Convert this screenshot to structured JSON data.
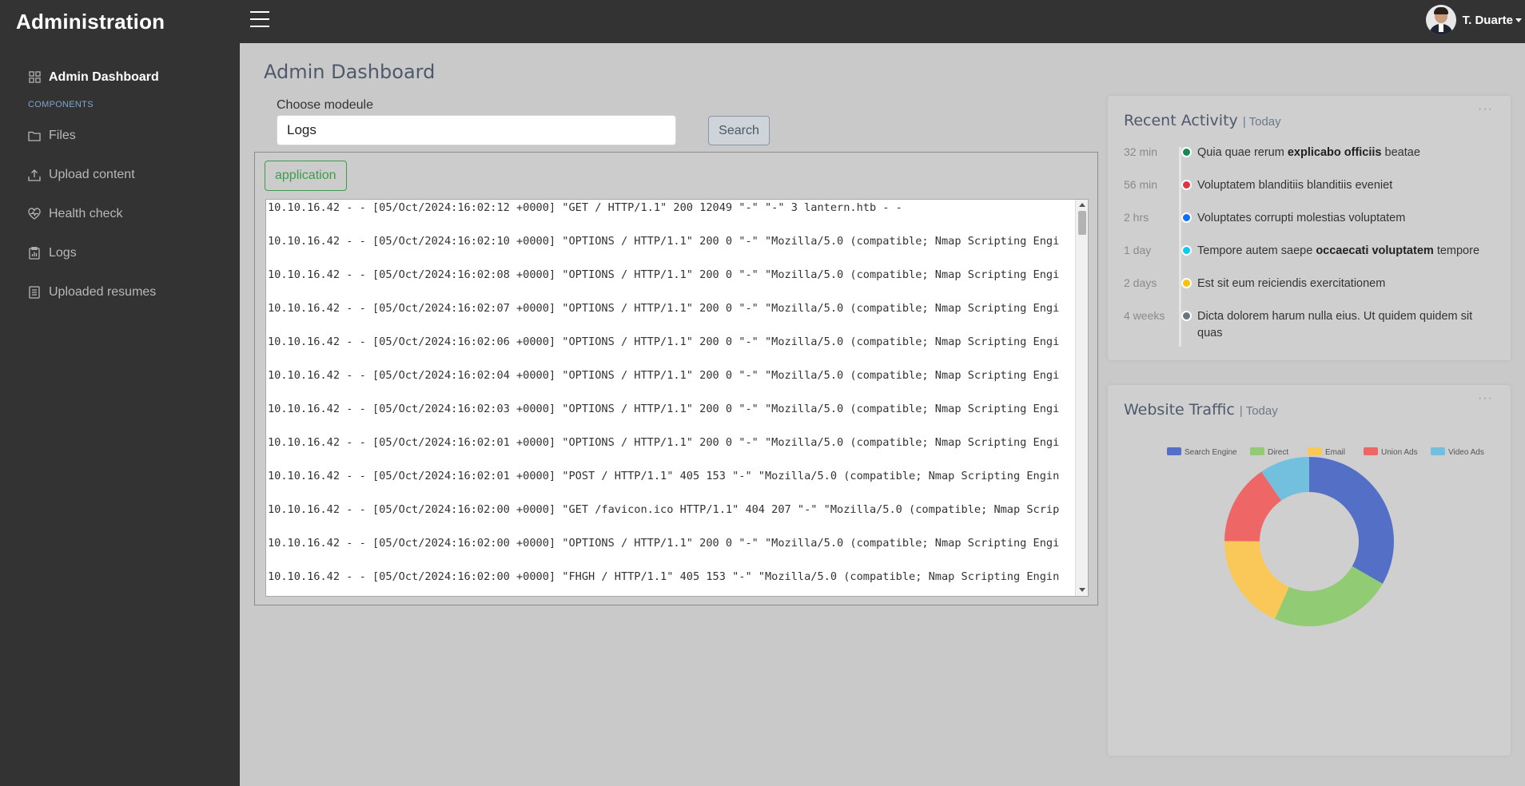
{
  "header": {
    "brand": "Administration",
    "user_name": "T. Duarte"
  },
  "sidebar": {
    "items": [
      {
        "label": "Admin Dashboard",
        "icon": "grid-icon"
      },
      {
        "heading": "COMPONENTS"
      },
      {
        "label": "Files",
        "icon": "folder-icon"
      },
      {
        "label": "Upload content",
        "icon": "upload-icon"
      },
      {
        "label": "Health check",
        "icon": "heart-pulse-icon"
      },
      {
        "label": "Logs",
        "icon": "clipboard-data-icon"
      },
      {
        "label": "Uploaded resumes",
        "icon": "document-list-icon"
      }
    ]
  },
  "main": {
    "title": "Admin Dashboard",
    "module_label": "Choose modeule",
    "module_value": "Logs",
    "search_label": "Search",
    "log_tab": "application",
    "log_lines": [
      "10.10.16.42 - - [05/Oct/2024:16:02:12 +0000] \"GET / HTTP/1.1\" 200 12049 \"-\" \"-\" 3 lantern.htb - -",
      "10.10.16.42 - - [05/Oct/2024:16:02:10 +0000] \"OPTIONS / HTTP/1.1\" 200 0 \"-\" \"Mozilla/5.0 (compatible; Nmap Scripting Engi",
      "10.10.16.42 - - [05/Oct/2024:16:02:08 +0000] \"OPTIONS / HTTP/1.1\" 200 0 \"-\" \"Mozilla/5.0 (compatible; Nmap Scripting Engi",
      "10.10.16.42 - - [05/Oct/2024:16:02:07 +0000] \"OPTIONS / HTTP/1.1\" 200 0 \"-\" \"Mozilla/5.0 (compatible; Nmap Scripting Engi",
      "10.10.16.42 - - [05/Oct/2024:16:02:06 +0000] \"OPTIONS / HTTP/1.1\" 200 0 \"-\" \"Mozilla/5.0 (compatible; Nmap Scripting Engi",
      "10.10.16.42 - - [05/Oct/2024:16:02:04 +0000] \"OPTIONS / HTTP/1.1\" 200 0 \"-\" \"Mozilla/5.0 (compatible; Nmap Scripting Engi",
      "10.10.16.42 - - [05/Oct/2024:16:02:03 +0000] \"OPTIONS / HTTP/1.1\" 200 0 \"-\" \"Mozilla/5.0 (compatible; Nmap Scripting Engi",
      "10.10.16.42 - - [05/Oct/2024:16:02:01 +0000] \"OPTIONS / HTTP/1.1\" 200 0 \"-\" \"Mozilla/5.0 (compatible; Nmap Scripting Engi",
      "10.10.16.42 - - [05/Oct/2024:16:02:01 +0000] \"POST / HTTP/1.1\" 405 153 \"-\" \"Mozilla/5.0 (compatible; Nmap Scripting Engin",
      "10.10.16.42 - - [05/Oct/2024:16:02:00 +0000] \"GET /favicon.ico HTTP/1.1\" 404 207 \"-\" \"Mozilla/5.0 (compatible; Nmap Scrip",
      "10.10.16.42 - - [05/Oct/2024:16:02:00 +0000] \"OPTIONS / HTTP/1.1\" 200 0 \"-\" \"Mozilla/5.0 (compatible; Nmap Scripting Engi",
      "10.10.16.42 - - [05/Oct/2024:16:02:00 +0000] \"FHGH / HTTP/1.1\" 405 153 \"-\" \"Mozilla/5.0 (compatible; Nmap Scripting Engin"
    ]
  },
  "activity": {
    "title": "Recent Activity",
    "subtitle": "| Today",
    "dots": "···",
    "items": [
      {
        "time": "32 min",
        "color": "#198754",
        "pre": "Quia quae rerum ",
        "bold": "explicabo officiis",
        "post": " beatae"
      },
      {
        "time": "56 min",
        "color": "#dc3545",
        "pre": "Voluptatem blanditiis blanditiis eveniet",
        "bold": "",
        "post": ""
      },
      {
        "time": "2 hrs",
        "color": "#0d6efd",
        "pre": "Voluptates corrupti molestias voluptatem",
        "bold": "",
        "post": ""
      },
      {
        "time": "1 day",
        "color": "#0dcaf0",
        "pre": "Tempore autem saepe ",
        "bold": "occaecati voluptatem",
        "post": " tempore"
      },
      {
        "time": "2 days",
        "color": "#ffc107",
        "pre": "Est sit eum reiciendis exercitationem",
        "bold": "",
        "post": ""
      },
      {
        "time": "4 weeks",
        "color": "#6c757d",
        "pre": "Dicta dolorem harum nulla eius. Ut quidem quidem sit quas",
        "bold": "",
        "post": ""
      }
    ]
  },
  "traffic": {
    "title": "Website Traffic",
    "subtitle": "| Today",
    "dots": "···"
  },
  "chart_data": {
    "type": "pie",
    "categories": [
      "Search Engine",
      "Direct",
      "Email",
      "Union Ads",
      "Video Ads"
    ],
    "values": [
      1048,
      735,
      580,
      484,
      300
    ],
    "colors": [
      "#5470c6",
      "#91cc75",
      "#fac858",
      "#ee6666",
      "#73c0de"
    ],
    "donut": true,
    "legend": "top"
  }
}
